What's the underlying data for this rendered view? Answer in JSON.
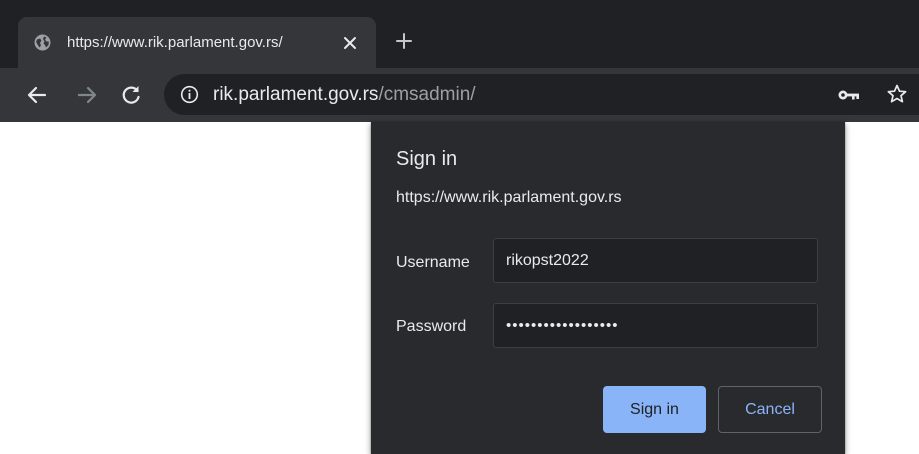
{
  "browser": {
    "tab": {
      "title": "https://www.rik.parlament.gov.rs/",
      "favicon": "globe-icon",
      "close_icon": "close-icon"
    },
    "new_tab_icon": "plus-icon",
    "toolbar": {
      "back_icon": "back-arrow-icon",
      "forward_icon": "forward-arrow-icon",
      "reload_icon": "reload-icon",
      "omnibox": {
        "info_icon": "info-icon",
        "url_host": "rik.parlament.gov.rs",
        "url_path": "/cmsadmin/",
        "key_icon": "key-icon",
        "star_icon": "star-icon"
      }
    }
  },
  "dialog": {
    "title": "Sign in",
    "origin": "https://www.rik.parlament.gov.rs",
    "username_label": "Username",
    "username_value": "rikopst2022",
    "password_label": "Password",
    "password_value": "••••••••••••••••••",
    "sign_in_label": "Sign in",
    "cancel_label": "Cancel"
  },
  "colors": {
    "tabstrip_bg": "#202124",
    "toolbar_bg": "#35363a",
    "dialog_bg": "#292a2d",
    "accent": "#8ab4f8"
  }
}
